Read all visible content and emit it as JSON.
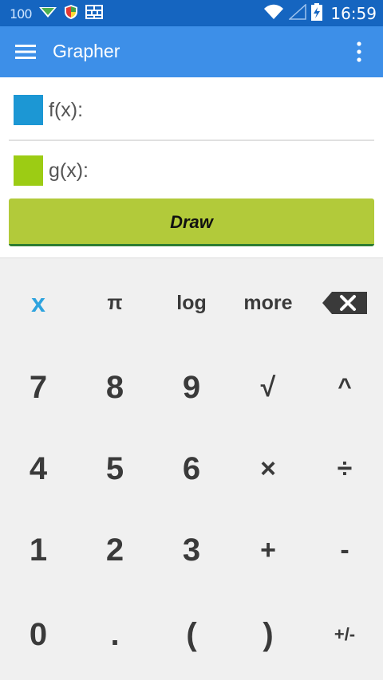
{
  "status_bar": {
    "battery_level": "100",
    "time": "16:59",
    "icons": [
      "battery-level-text",
      "send-icon",
      "shield-icon",
      "grid-app-icon",
      "wifi-icon",
      "signal-icon",
      "battery-charging-icon"
    ]
  },
  "app_bar": {
    "title": "Grapher",
    "menu_icon": "menu-icon",
    "overflow_icon": "overflow-menu-icon"
  },
  "functions": {
    "f": {
      "label": "f(x):",
      "value": "",
      "color": "#1c97d4"
    },
    "g": {
      "label": "g(x):",
      "value": "",
      "color": "#9ccc14"
    }
  },
  "draw_button": {
    "label": "Draw"
  },
  "keypad": {
    "row0": [
      "x",
      "π",
      "log",
      "more",
      "backspace"
    ],
    "row1": [
      "7",
      "8",
      "9",
      "√",
      "^"
    ],
    "row2": [
      "4",
      "5",
      "6",
      "×",
      "÷"
    ],
    "row3": [
      "1",
      "2",
      "3",
      "+",
      "-"
    ],
    "row4": [
      "0",
      ".",
      "(",
      ")",
      "+/-"
    ]
  },
  "colors": {
    "status_bar": "#1565c0",
    "app_bar": "#3d8fe8",
    "draw_button": "#b2ca3a",
    "x_key": "#2ea3de",
    "keypad_background": "#f0f0f0"
  }
}
